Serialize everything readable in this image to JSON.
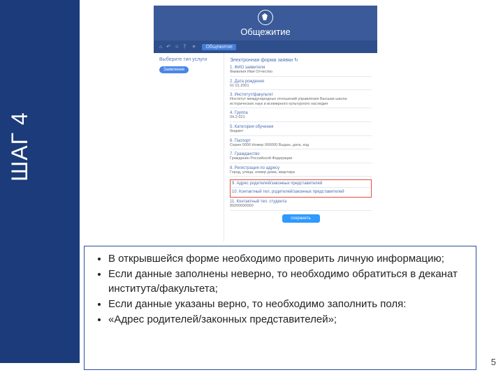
{
  "sidebar": {
    "step_label": "ШАГ 4"
  },
  "app": {
    "title": "Общежитие",
    "toolbar_icons": [
      "home",
      "back",
      "star",
      "help",
      "menu"
    ],
    "tab": "Общежитие",
    "left": {
      "title": "Выберите тип услуги",
      "tag": "Заявление"
    },
    "form": {
      "title": "Электронная форма заявки ↻",
      "fields": [
        {
          "label": "1. ФИО заявителя",
          "value": "Фамилия Имя Отчество"
        },
        {
          "label": "2. Дата рождения",
          "value": "01.01.2001"
        },
        {
          "label": "3. Институт/факультет",
          "value": "Институт международных отношений управления Высшая школа исторических наук и всемирного культурного наследия"
        },
        {
          "label": "4. Группа",
          "value": "04.2-021"
        },
        {
          "label": "5. Категория обучения",
          "value": "бюджет"
        },
        {
          "label": "6. Паспорт",
          "value": "Серия 0000 Номер 000000\nВыдан, дата, код"
        },
        {
          "label": "7. Гражданство",
          "value": "Гражданин Российской Федерации"
        },
        {
          "label": "8. Регистрация по адресу",
          "value": "Город, улица, номер дома, квартира"
        }
      ],
      "highlighted": [
        {
          "label": "9. Адрес родителей/законных представителей",
          "value": ""
        },
        {
          "label": "10. Контактный тел. родителей/законных представителей",
          "value": ""
        }
      ],
      "after_highlight": {
        "label": "11. Контактный тел. студента",
        "value": "89200000000"
      },
      "save_label": "сохранить"
    }
  },
  "instructions": {
    "items": [
      "В открывшейся форме необходимо проверить личную информацию;",
      "Если данные заполнены неверно, то необходимо обратиться в деканат института/факультета;",
      "Если данные указаны верно, то необходимо заполнить поля:",
      "«Адрес родителей/законных представителей»;"
    ]
  },
  "page_number": "5"
}
